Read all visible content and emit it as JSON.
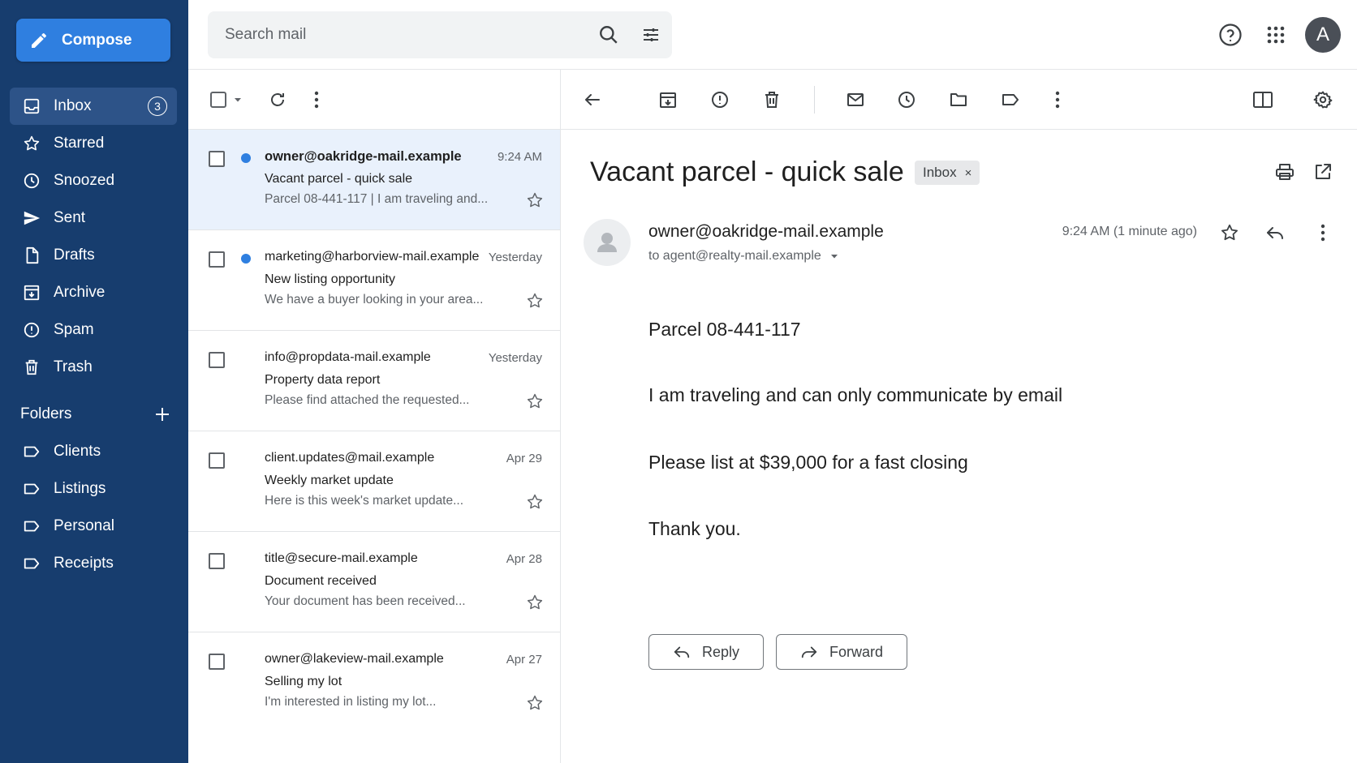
{
  "compose": {
    "label": "Compose"
  },
  "nav": [
    {
      "label": "Inbox",
      "icon": "inbox-icon",
      "badge": "3",
      "active": true
    },
    {
      "label": "Starred",
      "icon": "star-icon"
    },
    {
      "label": "Snoozed",
      "icon": "clock-icon"
    },
    {
      "label": "Sent",
      "icon": "send-icon"
    },
    {
      "label": "Drafts",
      "icon": "file-icon"
    },
    {
      "label": "Archive",
      "icon": "archive-icon"
    },
    {
      "label": "Spam",
      "icon": "spam-icon"
    },
    {
      "label": "Trash",
      "icon": "trash-icon"
    }
  ],
  "folders": {
    "title": "Folders",
    "items": [
      {
        "label": "Clients"
      },
      {
        "label": "Listings"
      },
      {
        "label": "Personal"
      },
      {
        "label": "Receipts"
      }
    ]
  },
  "search": {
    "placeholder": "Search mail"
  },
  "user": {
    "initial": "A"
  },
  "emails": [
    {
      "from": "owner@oakridge-mail.example",
      "time": "9:24 AM",
      "subject": "Vacant parcel - quick sale",
      "snippet": "Parcel 08-441-117 | I am traveling and...",
      "unread": true,
      "selected": true
    },
    {
      "from": "marketing@harborview-mail.example",
      "time": "Yesterday",
      "subject": "New listing opportunity",
      "snippet": "We have a buyer looking in your area...",
      "unread": true,
      "selected": false
    },
    {
      "from": "info@propdata-mail.example",
      "time": "Yesterday",
      "subject": "Property data report",
      "snippet": "Please find attached the requested...",
      "unread": false,
      "selected": false
    },
    {
      "from": "client.updates@mail.example",
      "time": "Apr 29",
      "subject": "Weekly market update",
      "snippet": "Here is this week's market update...",
      "unread": false,
      "selected": false
    },
    {
      "from": "title@secure-mail.example",
      "time": "Apr 28",
      "subject": "Document received",
      "snippet": "Your document has been received...",
      "unread": false,
      "selected": false
    },
    {
      "from": "owner@lakeview-mail.example",
      "time": "Apr 27",
      "subject": "Selling my lot",
      "snippet": "I'm interested in listing my lot...",
      "unread": false,
      "selected": false
    }
  ],
  "message": {
    "subject": "Vacant parcel - quick sale",
    "label": "Inbox",
    "label_close": "×",
    "from": "owner@oakridge-mail.example",
    "to": "to agent@realty-mail.example",
    "time": "9:24 AM (1 minute ago)",
    "body": [
      "Parcel 08-441-117",
      "I am traveling and can only communicate by email",
      "Please list at $39,000 for a fast closing",
      "Thank you."
    ],
    "reply_label": "Reply",
    "forward_label": "Forward"
  },
  "colors": {
    "sidebar": "#173d6e",
    "compose": "#2f7fe0",
    "unread_dot": "#2f7fe0"
  }
}
